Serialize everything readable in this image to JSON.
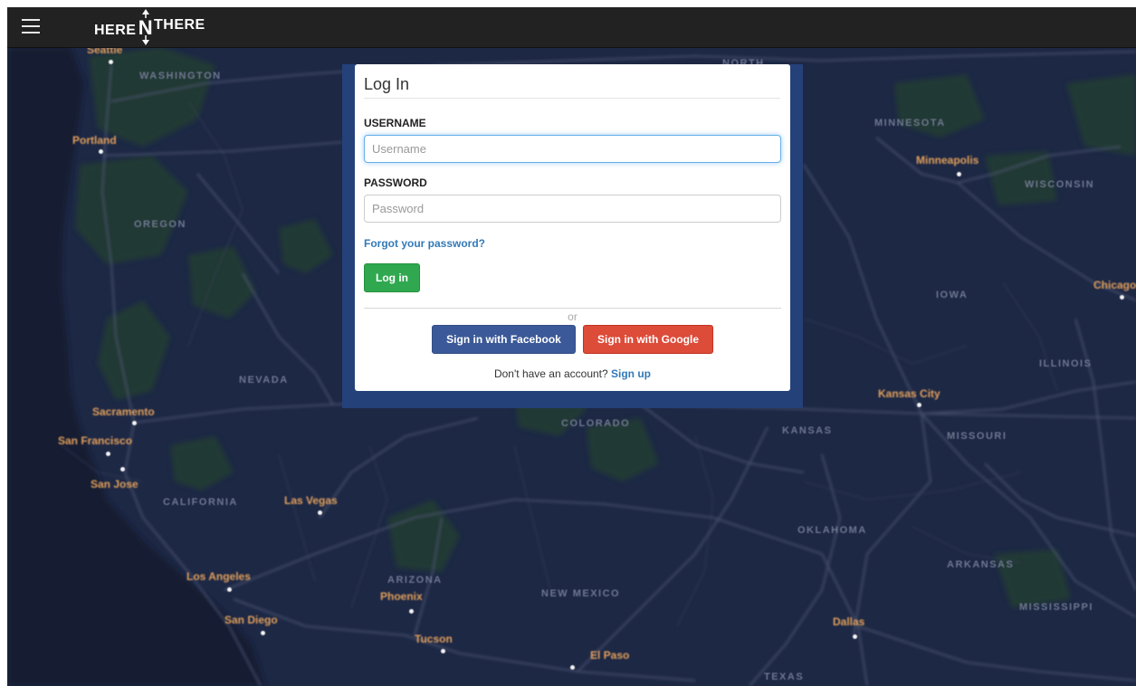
{
  "header": {
    "brand_left": "HERE",
    "brand_mid": "N",
    "brand_right": "THERE",
    "menu_icon": "hamburger-menu-icon"
  },
  "map": {
    "regions": [
      {
        "id": "washington",
        "label": "WASHINGTON"
      },
      {
        "id": "oregon",
        "label": "OREGON"
      },
      {
        "id": "nevada",
        "label": "NEVADA"
      },
      {
        "id": "california",
        "label": "CALIFORNIA"
      },
      {
        "id": "arizona",
        "label": "ARIZONA"
      },
      {
        "id": "new-mexico",
        "label": "NEW MEXICO"
      },
      {
        "id": "colorado",
        "label": "COLORADO"
      },
      {
        "id": "kansas",
        "label": "KANSAS"
      },
      {
        "id": "missouri",
        "label": "MISSOURI"
      },
      {
        "id": "oklahoma",
        "label": "OKLAHOMA"
      },
      {
        "id": "arkansas",
        "label": "ARKANSAS"
      },
      {
        "id": "mississippi",
        "label": "MISSISSIPPI"
      },
      {
        "id": "texas",
        "label": "TEXAS"
      },
      {
        "id": "iowa",
        "label": "IOWA"
      },
      {
        "id": "illinois",
        "label": "ILLINOIS"
      },
      {
        "id": "minnesota",
        "label": "MINNESOTA"
      },
      {
        "id": "wisconsin",
        "label": "WISCONSIN"
      },
      {
        "id": "north",
        "label": "NORTH"
      }
    ],
    "cities": [
      {
        "id": "seattle",
        "label": "Seattle"
      },
      {
        "id": "portland",
        "label": "Portland"
      },
      {
        "id": "sacramento",
        "label": "Sacramento"
      },
      {
        "id": "san-francisco",
        "label": "San Francisco"
      },
      {
        "id": "san-jose",
        "label": "San Jose"
      },
      {
        "id": "las-vegas",
        "label": "Las Vegas"
      },
      {
        "id": "los-angeles",
        "label": "Los Angeles"
      },
      {
        "id": "san-diego",
        "label": "San Diego"
      },
      {
        "id": "phoenix",
        "label": "Phoenix"
      },
      {
        "id": "tucson",
        "label": "Tucson"
      },
      {
        "id": "el-paso",
        "label": "El Paso"
      },
      {
        "id": "dallas",
        "label": "Dallas"
      },
      {
        "id": "kansas-city",
        "label": "Kansas City"
      },
      {
        "id": "minneapolis",
        "label": "Minneapolis"
      },
      {
        "id": "chicago",
        "label": "Chicago"
      }
    ]
  },
  "login": {
    "title": "Log In",
    "username_label": "USERNAME",
    "username_placeholder": "Username",
    "username_value": "",
    "password_label": "PASSWORD",
    "password_placeholder": "Password",
    "password_value": "",
    "forgot_link": "Forgot your password?",
    "submit_label": "Log in",
    "divider_text": "or",
    "facebook_label": "Sign in with Facebook",
    "google_label": "Sign in with Google",
    "signup_prompt": "Don't have an account?",
    "signup_link": "Sign up"
  },
  "colors": {
    "navbar_bg": "#222222",
    "map_bg": "#1a2440",
    "modal_frame": "#25417a",
    "login_button": "#2fa84f",
    "facebook": "#3b5998",
    "google": "#dd4b39",
    "link": "#337ab7",
    "city_label": "#e2a05b"
  }
}
